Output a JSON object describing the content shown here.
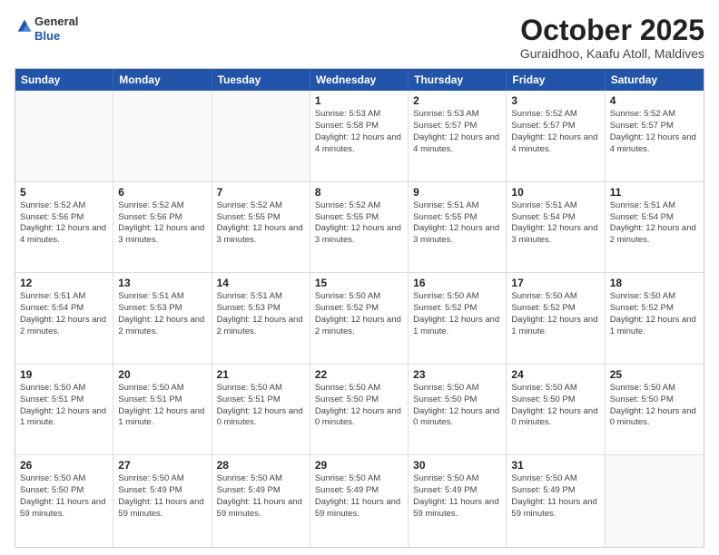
{
  "header": {
    "logo_general": "General",
    "logo_blue": "Blue",
    "month_title": "October 2025",
    "location": "Guraidhoo, Kaafu Atoll, Maldives"
  },
  "calendar": {
    "days_of_week": [
      "Sunday",
      "Monday",
      "Tuesday",
      "Wednesday",
      "Thursday",
      "Friday",
      "Saturday"
    ],
    "rows": [
      [
        {
          "day": "",
          "empty": true
        },
        {
          "day": "",
          "empty": true
        },
        {
          "day": "",
          "empty": true
        },
        {
          "day": "1",
          "sunrise": "Sunrise: 5:53 AM",
          "sunset": "Sunset: 5:58 PM",
          "daylight": "Daylight: 12 hours and 4 minutes."
        },
        {
          "day": "2",
          "sunrise": "Sunrise: 5:53 AM",
          "sunset": "Sunset: 5:57 PM",
          "daylight": "Daylight: 12 hours and 4 minutes."
        },
        {
          "day": "3",
          "sunrise": "Sunrise: 5:52 AM",
          "sunset": "Sunset: 5:57 PM",
          "daylight": "Daylight: 12 hours and 4 minutes."
        },
        {
          "day": "4",
          "sunrise": "Sunrise: 5:52 AM",
          "sunset": "Sunset: 5:57 PM",
          "daylight": "Daylight: 12 hours and 4 minutes."
        }
      ],
      [
        {
          "day": "5",
          "sunrise": "Sunrise: 5:52 AM",
          "sunset": "Sunset: 5:56 PM",
          "daylight": "Daylight: 12 hours and 4 minutes."
        },
        {
          "day": "6",
          "sunrise": "Sunrise: 5:52 AM",
          "sunset": "Sunset: 5:56 PM",
          "daylight": "Daylight: 12 hours and 3 minutes."
        },
        {
          "day": "7",
          "sunrise": "Sunrise: 5:52 AM",
          "sunset": "Sunset: 5:55 PM",
          "daylight": "Daylight: 12 hours and 3 minutes."
        },
        {
          "day": "8",
          "sunrise": "Sunrise: 5:52 AM",
          "sunset": "Sunset: 5:55 PM",
          "daylight": "Daylight: 12 hours and 3 minutes."
        },
        {
          "day": "9",
          "sunrise": "Sunrise: 5:51 AM",
          "sunset": "Sunset: 5:55 PM",
          "daylight": "Daylight: 12 hours and 3 minutes."
        },
        {
          "day": "10",
          "sunrise": "Sunrise: 5:51 AM",
          "sunset": "Sunset: 5:54 PM",
          "daylight": "Daylight: 12 hours and 3 minutes."
        },
        {
          "day": "11",
          "sunrise": "Sunrise: 5:51 AM",
          "sunset": "Sunset: 5:54 PM",
          "daylight": "Daylight: 12 hours and 2 minutes."
        }
      ],
      [
        {
          "day": "12",
          "sunrise": "Sunrise: 5:51 AM",
          "sunset": "Sunset: 5:54 PM",
          "daylight": "Daylight: 12 hours and 2 minutes."
        },
        {
          "day": "13",
          "sunrise": "Sunrise: 5:51 AM",
          "sunset": "Sunset: 5:53 PM",
          "daylight": "Daylight: 12 hours and 2 minutes."
        },
        {
          "day": "14",
          "sunrise": "Sunrise: 5:51 AM",
          "sunset": "Sunset: 5:53 PM",
          "daylight": "Daylight: 12 hours and 2 minutes."
        },
        {
          "day": "15",
          "sunrise": "Sunrise: 5:50 AM",
          "sunset": "Sunset: 5:52 PM",
          "daylight": "Daylight: 12 hours and 2 minutes."
        },
        {
          "day": "16",
          "sunrise": "Sunrise: 5:50 AM",
          "sunset": "Sunset: 5:52 PM",
          "daylight": "Daylight: 12 hours and 1 minute."
        },
        {
          "day": "17",
          "sunrise": "Sunrise: 5:50 AM",
          "sunset": "Sunset: 5:52 PM",
          "daylight": "Daylight: 12 hours and 1 minute."
        },
        {
          "day": "18",
          "sunrise": "Sunrise: 5:50 AM",
          "sunset": "Sunset: 5:52 PM",
          "daylight": "Daylight: 12 hours and 1 minute."
        }
      ],
      [
        {
          "day": "19",
          "sunrise": "Sunrise: 5:50 AM",
          "sunset": "Sunset: 5:51 PM",
          "daylight": "Daylight: 12 hours and 1 minute."
        },
        {
          "day": "20",
          "sunrise": "Sunrise: 5:50 AM",
          "sunset": "Sunset: 5:51 PM",
          "daylight": "Daylight: 12 hours and 1 minute."
        },
        {
          "day": "21",
          "sunrise": "Sunrise: 5:50 AM",
          "sunset": "Sunset: 5:51 PM",
          "daylight": "Daylight: 12 hours and 0 minutes."
        },
        {
          "day": "22",
          "sunrise": "Sunrise: 5:50 AM",
          "sunset": "Sunset: 5:50 PM",
          "daylight": "Daylight: 12 hours and 0 minutes."
        },
        {
          "day": "23",
          "sunrise": "Sunrise: 5:50 AM",
          "sunset": "Sunset: 5:50 PM",
          "daylight": "Daylight: 12 hours and 0 minutes."
        },
        {
          "day": "24",
          "sunrise": "Sunrise: 5:50 AM",
          "sunset": "Sunset: 5:50 PM",
          "daylight": "Daylight: 12 hours and 0 minutes."
        },
        {
          "day": "25",
          "sunrise": "Sunrise: 5:50 AM",
          "sunset": "Sunset: 5:50 PM",
          "daylight": "Daylight: 12 hours and 0 minutes."
        }
      ],
      [
        {
          "day": "26",
          "sunrise": "Sunrise: 5:50 AM",
          "sunset": "Sunset: 5:50 PM",
          "daylight": "Daylight: 11 hours and 59 minutes."
        },
        {
          "day": "27",
          "sunrise": "Sunrise: 5:50 AM",
          "sunset": "Sunset: 5:49 PM",
          "daylight": "Daylight: 11 hours and 59 minutes."
        },
        {
          "day": "28",
          "sunrise": "Sunrise: 5:50 AM",
          "sunset": "Sunset: 5:49 PM",
          "daylight": "Daylight: 11 hours and 59 minutes."
        },
        {
          "day": "29",
          "sunrise": "Sunrise: 5:50 AM",
          "sunset": "Sunset: 5:49 PM",
          "daylight": "Daylight: 11 hours and 59 minutes."
        },
        {
          "day": "30",
          "sunrise": "Sunrise: 5:50 AM",
          "sunset": "Sunset: 5:49 PM",
          "daylight": "Daylight: 11 hours and 59 minutes."
        },
        {
          "day": "31",
          "sunrise": "Sunrise: 5:50 AM",
          "sunset": "Sunset: 5:49 PM",
          "daylight": "Daylight: 11 hours and 59 minutes."
        },
        {
          "day": "",
          "empty": true
        }
      ]
    ]
  }
}
